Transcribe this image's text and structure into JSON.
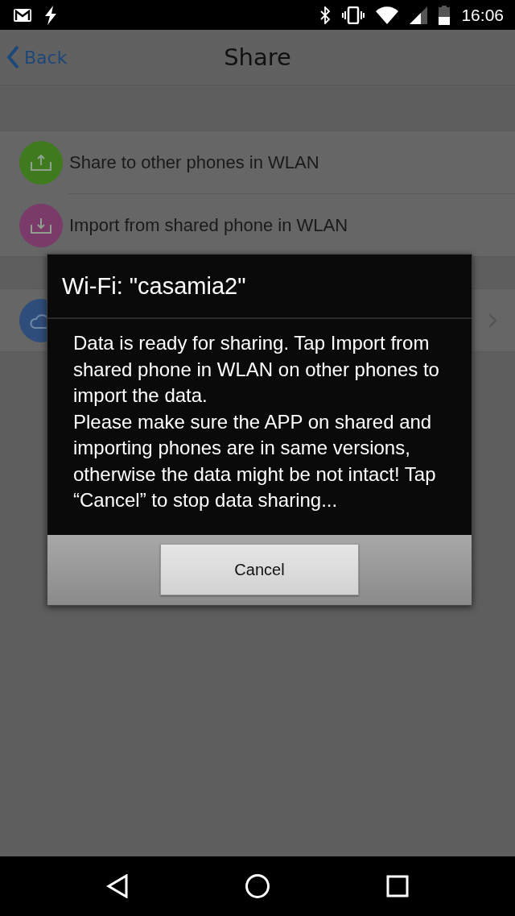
{
  "status_bar": {
    "time": "16:06"
  },
  "nav": {
    "back": "Back",
    "title": "Share"
  },
  "items": [
    {
      "kind": "upload",
      "label": "Share to other phones in WLAN"
    },
    {
      "kind": "download",
      "label": "Import from shared phone in WLAN"
    },
    {
      "kind": "cloud"
    }
  ],
  "dialog": {
    "title": "Wi-Fi: \"casamia2\"",
    "message": [
      "Data is ready for sharing. Tap Import from shared phone in WLAN on other phones to import the data.",
      "Please make sure the APP on shared and importing phones are in same versions, otherwise the data might be not intact! Tap “Cancel” to stop data sharing..."
    ],
    "buttons": [
      "Cancel"
    ]
  }
}
